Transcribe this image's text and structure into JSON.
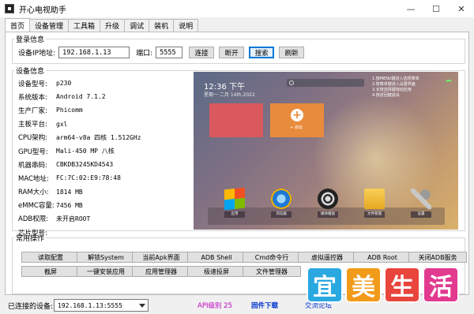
{
  "window": {
    "title": "开心电视助手",
    "minimize": "—",
    "maximize": "☐",
    "close": "✕"
  },
  "tabs": [
    "首页",
    "设备管理",
    "工具箱",
    "升级",
    "调试",
    "装机",
    "说明"
  ],
  "login": {
    "legend": "登录信息",
    "ip_label": "设备IP地址:",
    "ip_value": "192.168.1.13",
    "port_label": "端口:",
    "port_value": "5555",
    "connect": "连接",
    "disconnect": "断开",
    "search": "搜索",
    "refresh": "刷新"
  },
  "device": {
    "legend": "设备信息",
    "rows": [
      {
        "k": "设备型号:",
        "v": "p230"
      },
      {
        "k": "系统版本:",
        "v": "Android 7.1.2"
      },
      {
        "k": "生产厂家:",
        "v": "Phicomm"
      },
      {
        "k": "主板平台:",
        "v": "gxl"
      },
      {
        "k": "CPU架构:",
        "v": "arm64-v8a 四核 1.512GHz"
      },
      {
        "k": "GPU型号:",
        "v": "Mali-450 MP 八核"
      },
      {
        "k": "机器串码:",
        "v": "CBKDB3245KD4543"
      },
      {
        "k": "MAC地址:",
        "v": "FC:7C:02:E9:78:48"
      },
      {
        "k": "RAM大小:",
        "v": "1814 MB"
      },
      {
        "k": "eMMC容量:",
        "v": "7456 MB"
      },
      {
        "k": "ADB权限:",
        "v": "未开启ROOT"
      },
      {
        "k": "芯片型号:",
        "v": ""
      }
    ]
  },
  "tv": {
    "time": "12:36 下午",
    "date": "星期一  二月 14th,2022",
    "notes": [
      "1.按MENU键进入选项菜单",
      "2.按菜单键进入设置界面",
      "3.长按选择键拖动应用",
      "4.按返回键退出"
    ],
    "add_label": "+ 添加",
    "apps": [
      "应用",
      "浏览器",
      "媒体播放",
      "文件管理",
      "设置"
    ]
  },
  "common": {
    "legend": "常用操作",
    "row1": [
      "读取配置",
      "解锁System",
      "当前Apk界面",
      "ADB Shell",
      "Cmd命令行",
      "虚拟遥控器",
      "ADB Root",
      "关闭ADB服务"
    ],
    "row2": [
      "截屏",
      "一键安装应用",
      "应用管理器",
      "极速投屏",
      "文件管理器"
    ]
  },
  "status": {
    "label": "已连接的设备:",
    "device": "192.168.1.13:5555",
    "api": "API级别 25",
    "firmware": "固件下载",
    "more": "交流论坛"
  },
  "watermark": {
    "chars": [
      "宜",
      "美",
      "生",
      "活"
    ],
    "colors": [
      "#2aa8e0",
      "#f29a1a",
      "#e8453c",
      "#e23a8f"
    ]
  }
}
